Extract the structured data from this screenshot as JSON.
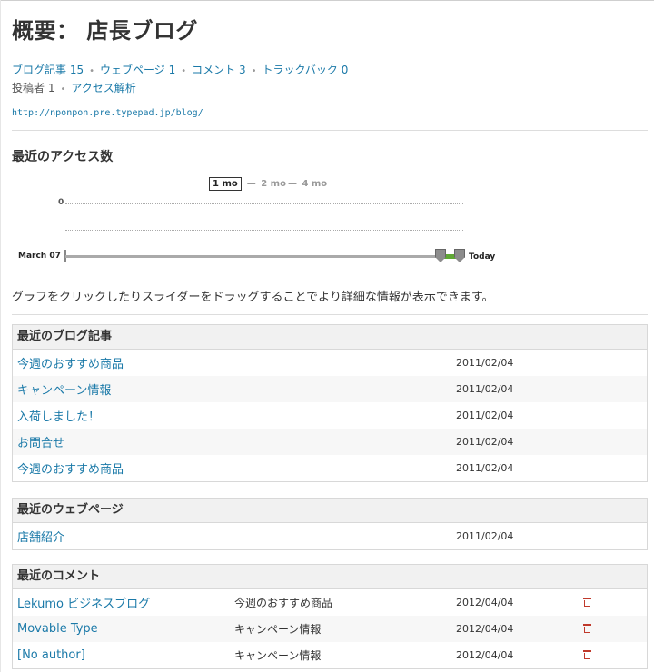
{
  "header": {
    "title": "概要： 店長ブログ"
  },
  "stats": {
    "blog_posts": "ブログ記事 15",
    "web_pages": "ウェブページ 1",
    "comments": "コメント 3",
    "trackbacks": "トラックバック 0",
    "authors": "投稿者 1",
    "access": "アクセス解析",
    "url": "http://nponpon.pre.typepad.jp/blog/"
  },
  "access_chart": {
    "heading": "最近のアクセス数",
    "ranges": [
      "1 mo",
      "2 mo",
      "4 mo"
    ],
    "selected_range": "1 mo",
    "zero_label": "0",
    "start_label": "March 07",
    "end_label": "Today",
    "note": "グラフをクリックしたりスライダーをドラッグすることでより詳細な情報が表示できます。"
  },
  "chart_data": {
    "type": "line",
    "y_tick_labels": [
      "0"
    ],
    "x_start": "March 07",
    "x_end": "Today",
    "selected_range": "1 mo"
  },
  "recent_posts": {
    "heading": "最近のブログ記事",
    "rows": [
      {
        "title": "今週のおすすめ商品",
        "date": "2011/02/04"
      },
      {
        "title": "キャンペーン情報",
        "date": "2011/02/04"
      },
      {
        "title": "入荷しました！",
        "date": "2011/02/04"
      },
      {
        "title": "お問合せ",
        "date": "2011/02/04"
      },
      {
        "title": "今週のおすすめ商品",
        "date": "2011/02/04"
      }
    ]
  },
  "recent_pages": {
    "heading": "最近のウェブページ",
    "rows": [
      {
        "title": "店舗紹介",
        "date": "2011/02/04"
      }
    ]
  },
  "recent_comments": {
    "heading": "最近のコメント",
    "rows": [
      {
        "author": "Lekumo ビジネスブログ",
        "entry": "今週のおすすめ商品",
        "date": "2012/04/04",
        "icon": "trash-icon"
      },
      {
        "author": "Movable Type",
        "entry": "キャンペーン情報",
        "date": "2012/04/04",
        "icon": "trash-icon"
      },
      {
        "author": "[No author]",
        "entry": "キャンペーン情報",
        "date": "2012/04/04",
        "icon": "trash-icon"
      }
    ]
  },
  "colors": {
    "link": "#1a79a8",
    "panel_header": "#f1f1f1",
    "slider_selection": "#5fa834",
    "delete": "#c0392b"
  }
}
